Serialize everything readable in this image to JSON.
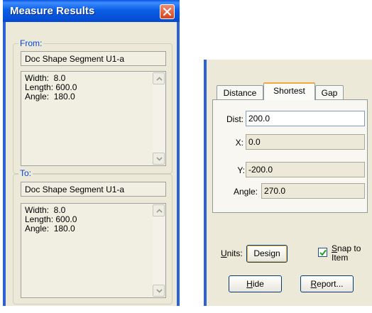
{
  "dialog": {
    "title": "Measure Results",
    "from": {
      "label": "From:",
      "element": "Doc Shape Segment U1-a",
      "details": [
        "Width:  8.0",
        "Length: 600.0",
        "Angle:  180.0"
      ]
    },
    "to": {
      "label": "To:",
      "element": "Doc Shape Segment U1-a",
      "details": [
        "Width:  8.0",
        "Length: 600.0",
        "Angle:  180.0"
      ]
    }
  },
  "panel": {
    "tabs": [
      {
        "label": "Distance",
        "active": false
      },
      {
        "label": "Shortest",
        "active": true
      },
      {
        "label": "Gap",
        "active": false
      }
    ],
    "fields": {
      "dist": {
        "label": "Dist:",
        "value": "200.0"
      },
      "x": {
        "label": "X:",
        "value": "0.0"
      },
      "y": {
        "label": "Y:",
        "value": "-200.0"
      },
      "angle": {
        "label": "Angle:",
        "value": "270.0"
      }
    },
    "units": {
      "label_u": "U",
      "label_rest": "nits:",
      "button": "Design"
    },
    "snap": {
      "checked": true,
      "u": "S",
      "rest1": "nap to",
      "line2": "Item"
    },
    "hide": {
      "u": "H",
      "rest": "ide"
    },
    "report": {
      "u": "R",
      "rest": "eport..."
    }
  },
  "colors": {
    "title_bar": "#0a5fe6",
    "face": "#ece9d8",
    "accent_tab": "#f2a83a",
    "close_button": "#d6451e"
  }
}
